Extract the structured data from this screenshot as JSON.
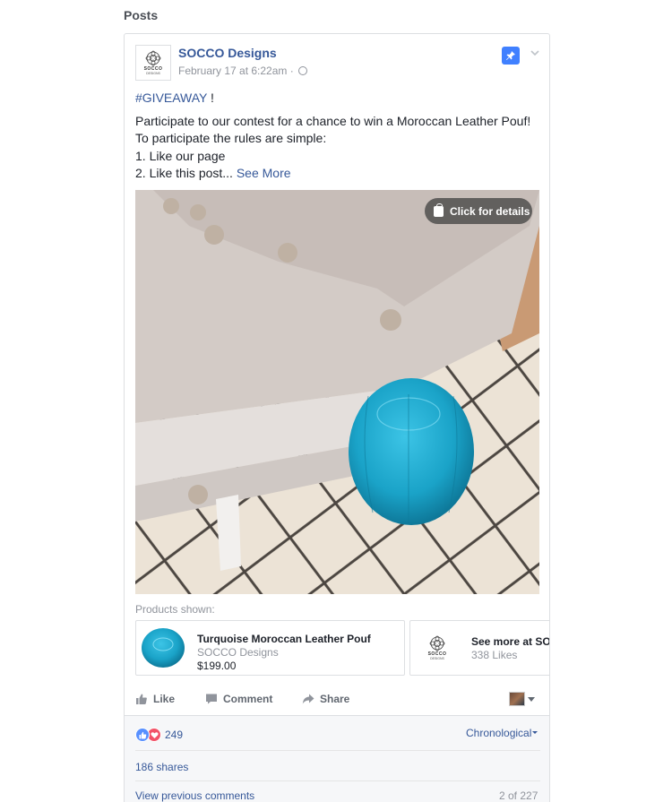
{
  "section": {
    "title": "Posts"
  },
  "post": {
    "page_name": "SOCCO Designs",
    "logo_text": "SOCCO",
    "logo_subtext": "DESIGNS",
    "timestamp": "February 17 at 6:22am ·",
    "hashtag": "#GIVEAWAY",
    "hashtag_suffix": " !",
    "lines": [
      "Participate to our contest for a chance to win a Moroccan Leather Pouf!",
      "To participate the rules are simple:",
      "1. Like our page"
    ],
    "last_line": "2. Like this post... ",
    "see_more": "See More",
    "photo_button": "Click for details"
  },
  "products": {
    "label": "Products shown:",
    "items": [
      {
        "name": "Turquoise Moroccan Leather Pouf",
        "seller": "SOCCO Designs",
        "price": "$199.00"
      },
      {
        "name": "See more at SOCCO",
        "seller": "338 Likes"
      }
    ]
  },
  "actions": {
    "like": "Like",
    "comment": "Comment",
    "share": "Share"
  },
  "footer": {
    "reaction_count": "249",
    "sort_label": "Chronological",
    "shares": "186 shares",
    "view_previous": "View previous comments",
    "page_count": "2 of 227"
  },
  "colors": {
    "link": "#365899",
    "pin": "#4080ff",
    "like": "#5890ff",
    "love": "#f25268",
    "pouf": "#1aa3c8"
  },
  "icons": [
    "socco-logo-icon",
    "globe-icon",
    "pin-icon",
    "chevron-down-icon",
    "shopping-bag-icon",
    "like-icon",
    "comment-icon",
    "share-icon",
    "like-reaction-icon",
    "love-reaction-icon"
  ]
}
